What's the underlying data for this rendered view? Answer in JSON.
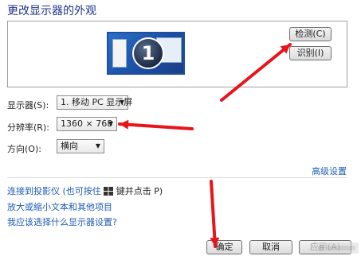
{
  "title": "更改显示器的外观",
  "monitor_preview": {
    "number": "1"
  },
  "buttons": {
    "detect": "检测(C)",
    "identify": "识别(I)",
    "ok": "确定",
    "cancel": "取消",
    "apply": "应用(A)"
  },
  "fields": {
    "display": {
      "label": "显示器(S):",
      "value": "1. 移动 PC 显示屏"
    },
    "resolution": {
      "label": "分辨率(R):",
      "value": "1360 × 768"
    },
    "orientation": {
      "label": "方向(O):",
      "value": "横向"
    }
  },
  "links": {
    "advanced": "高级设置",
    "projector_prefix": "连接到投影仪 (也可按住",
    "projector_suffix": "键并点击 P)",
    "enlarge_text": "放大或缩小文本和其他项目",
    "which_settings": "我应该选择什么显示器设置?"
  },
  "annotation_color": "#e8141b",
  "icons": {
    "windows_key": "windows-logo-icon",
    "dropdown": "chevron-down-icon"
  }
}
